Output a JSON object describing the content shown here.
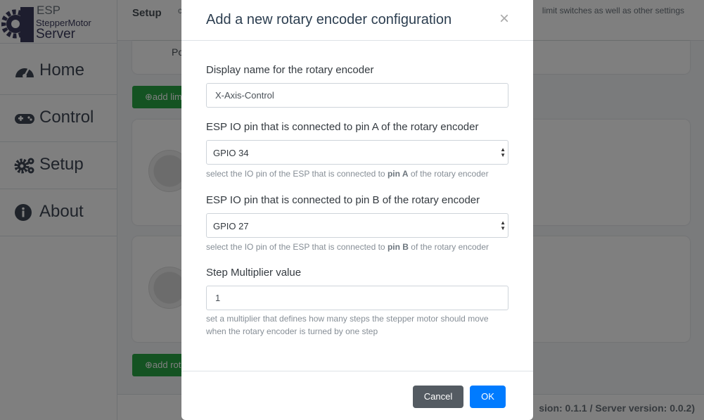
{
  "brand": {
    "line1": "ESP",
    "line2": "StepperMotor",
    "line3": "Server"
  },
  "sidebar": {
    "items": [
      {
        "label": "Home",
        "icon": "tachometer-icon"
      },
      {
        "label": "Control",
        "icon": "gamepad-icon"
      },
      {
        "label": "Setup",
        "icon": "gears-icon"
      },
      {
        "label": "About",
        "icon": "info-circle-icon"
      }
    ]
  },
  "background": {
    "page_title": "Setup",
    "page_title_fragment": "c",
    "description_fragment": "limit switches as well as other settings",
    "card_fragment": "Po",
    "add_limit_button": "add lim",
    "add_rotary_button": "add rot",
    "footer_version": "sion: 0.1.1 / Server version: 0.0.2)"
  },
  "modal": {
    "title": "Add a new rotary encoder configuration",
    "close_symbol": "×",
    "display_name": {
      "label": "Display name for the rotary encoder",
      "value": "X-Axis-Control"
    },
    "pin_a": {
      "label": "ESP IO pin that is connected to pin A of the rotary encoder",
      "selected": "GPIO 34",
      "help_prefix": "select the IO pin of the ESP that is connected to ",
      "help_bold": "pin A",
      "help_suffix": " of the rotary encoder"
    },
    "pin_b": {
      "label": "ESP IO pin that is connected to pin B of the rotary encoder",
      "selected": "GPIO 27",
      "help_prefix": "select the IO pin of the ESP that is connected to ",
      "help_bold": "pin B",
      "help_suffix": " of the rotary encoder"
    },
    "step_multiplier": {
      "label": "Step Multiplier value",
      "value": "1",
      "help": "set a multiplier that defines how many steps the stepper motor should move when the rotary encoder is turned by one step"
    },
    "cancel_label": "Cancel",
    "ok_label": "OK"
  },
  "colors": {
    "ok_button": "#007bff",
    "cancel_button": "#545b62",
    "green_button": "#28a745",
    "brand": "#3b3b5c"
  }
}
